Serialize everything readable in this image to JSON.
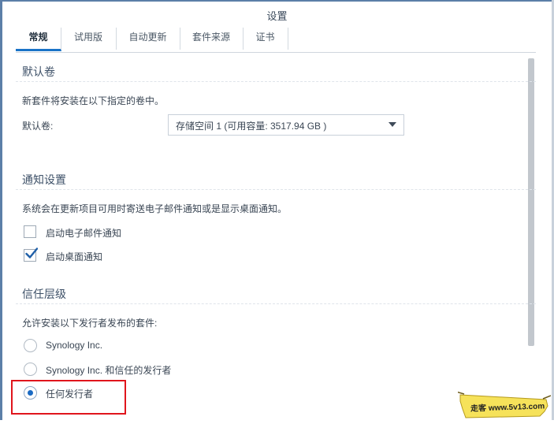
{
  "window": {
    "title": "设置"
  },
  "tabs": [
    {
      "label": "常规",
      "active": true
    },
    {
      "label": "试用版",
      "active": false
    },
    {
      "label": "自动更新",
      "active": false
    },
    {
      "label": "套件来源",
      "active": false
    },
    {
      "label": "证书",
      "active": false
    }
  ],
  "default_volume": {
    "title": "默认卷",
    "description": "新套件将安装在以下指定的卷中。",
    "label": "默认卷:",
    "selected": "存储空间 1 (可用容量:  3517.94 GB )"
  },
  "notifications": {
    "title": "通知设置",
    "description": "系统会在更新项目可用时寄送电子邮件通知或是显示桌面通知。",
    "options": [
      {
        "label": "启动电子邮件通知",
        "checked": false
      },
      {
        "label": "启动桌面通知",
        "checked": true
      }
    ]
  },
  "trust_level": {
    "title": "信任层级",
    "description": "允许安装以下发行者发布的套件:",
    "options": [
      {
        "label": "Synology Inc.",
        "selected": false
      },
      {
        "label": "Synology Inc. 和信任的发行者",
        "selected": false
      },
      {
        "label": "任何发行者",
        "selected": true
      }
    ]
  },
  "watermark": {
    "text": "走客 www.5v13.com"
  },
  "colors": {
    "accent": "#1a73c7",
    "highlight": "#e0151c",
    "badge": "#f6e25a"
  }
}
